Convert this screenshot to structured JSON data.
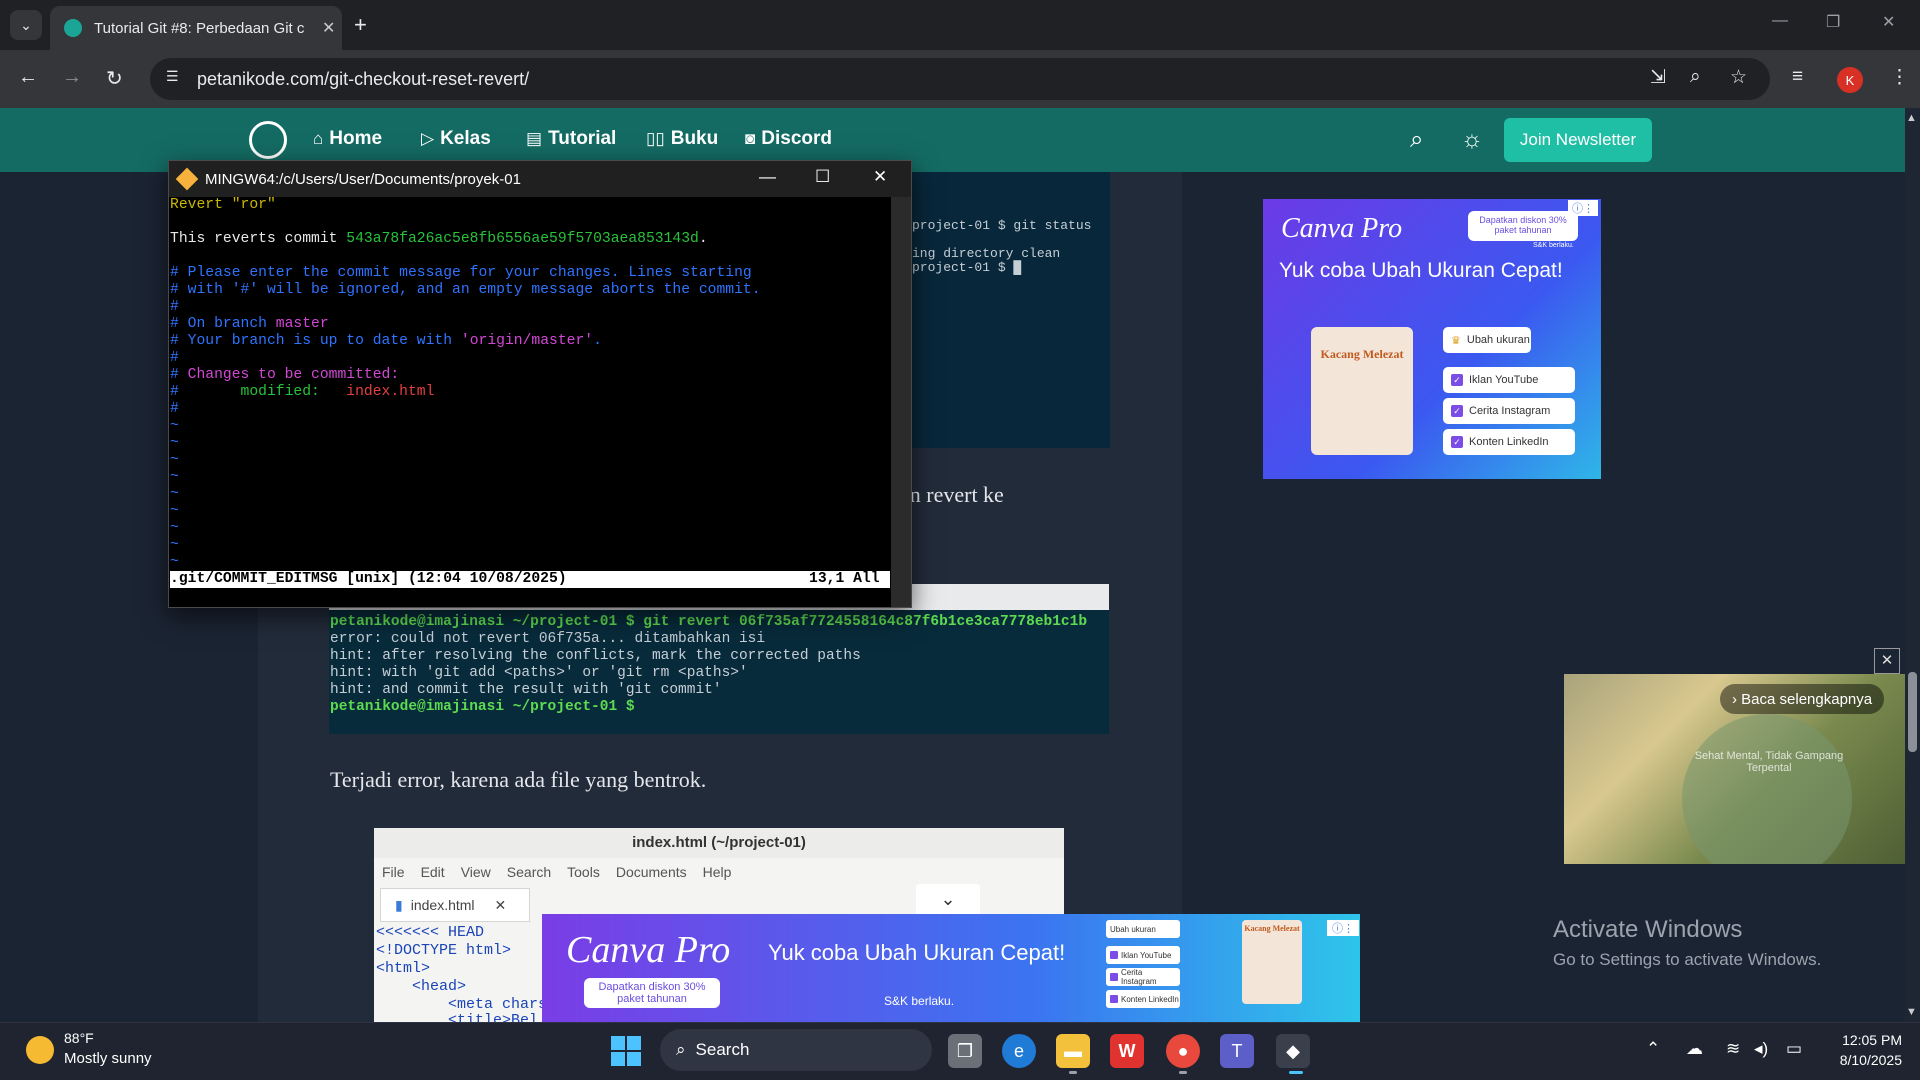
{
  "browser": {
    "tab_title": "Tutorial Git #8: Perbedaan Git c",
    "tab_close": "✕",
    "new_tab": "+",
    "url": "petanikode.com/git-checkout-reset-revert/",
    "profile_initial": "K",
    "accent": "#1aa597"
  },
  "site_nav": {
    "items": [
      "Home",
      "Kelas",
      "Tutorial",
      "Buku",
      "Discord"
    ],
    "join_button": "Join Newsletter",
    "header_color": "#146b63",
    "button_color": "#1fbfa5"
  },
  "article": {
    "para_revert_fragment": "an revert ke",
    "para_error": "Terjadi error, karena ada file yang bentrok."
  },
  "bg_terminal_1": {
    "lines": [
      "project-01 $ git status",
      "ing directory clean",
      "project-01 $ █"
    ]
  },
  "bg_terminal_2": {
    "lines": [
      "petanikode@imajinasi ~/project-01 $ git revert 06f735af7724558164c87f6b1ce3ca7778eb1c1b",
      "error: could not revert 06f735a... ditambahkan isi",
      "hint: after resolving the conflicts, mark the corrected paths",
      "hint: with 'git add <paths>' or 'git rm <paths>'",
      "hint: and commit the result with 'git commit'",
      "petanikode@imajinasi ~/project-01 $"
    ]
  },
  "gedit": {
    "title": "index.html (~/project-01)",
    "menu": [
      "File",
      "Edit",
      "View",
      "Search",
      "Tools",
      "Documents",
      "Help"
    ],
    "tab": "index.html",
    "code": [
      "<<<<<<< HEAD",
      "<!DOCTYPE html>",
      "<html>",
      "    <head>",
      "        <meta chars",
      "        <title>Bel"
    ]
  },
  "ad_canva_1": {
    "logo": "Canva Pro",
    "headline": "Yuk coba Ubah Ukuran Cepat!",
    "badge": "Dapatkan diskon 30% paket tahunan",
    "note": "S&K berlaku.",
    "book_title": "Kacang Melezat",
    "panel_title": "Ubah ukuran",
    "options": [
      "Iklan YouTube",
      "Cerita Instagram",
      "Konten LinkedIn"
    ]
  },
  "ad_canva_2": {
    "logo": "Canva Pro",
    "headline": "Yuk coba Ubah Ukuran Cepat!",
    "badge": "Dapatkan diskon 30% paket tahunan",
    "note": "S&K berlaku.",
    "panel_title": "Ubah ukuran",
    "options": [
      "Iklan YouTube",
      "Cerita Instagram",
      "Konten LinkedIn"
    ],
    "book_title": "Kacang Melezat"
  },
  "video_ad": {
    "read_more": "Baca selengkapnya",
    "caption": "Sehat Mental, Tidak Gampang Terpental"
  },
  "windows_watermark": {
    "title": "Activate Windows",
    "subtitle": "Go to Settings to activate Windows."
  },
  "terminal": {
    "title": "MINGW64:/c/Users/User/Documents/proyek-01",
    "line1": "Revert \"ror\"",
    "line2": "This reverts commit ",
    "commit_hash": "543a78fa26ac5e8fb6556ae59f5703aea853143d",
    "line2_end": ".",
    "comment1": "# Please enter the commit message for your changes. Lines starting",
    "comment2": "# with '#' will be ignored, and an empty message aborts the commit.",
    "comment3": "#",
    "comment4_prefix": "# On branch ",
    "branch": "master",
    "comment5_prefix": "# Your branch is up to date with ",
    "remote": "'origin/master'",
    "comment5_end": ".",
    "comment6": "#",
    "comment7_prefix": "# ",
    "changes": "Changes to be committed:",
    "comment8_prefix": "#       ",
    "modified_label": "modified:",
    "modified_file": "   index.html",
    "comment9": "#",
    "tilde": "~",
    "status_left": ".git/COMMIT_EDITMSG [unix] (12:04 10/08/2025)",
    "status_right": "13,1 All"
  },
  "taskbar": {
    "temp": "88°F",
    "weather": "Mostly sunny",
    "search": "Search",
    "time": "12:05 PM",
    "date": "8/10/2025"
  }
}
